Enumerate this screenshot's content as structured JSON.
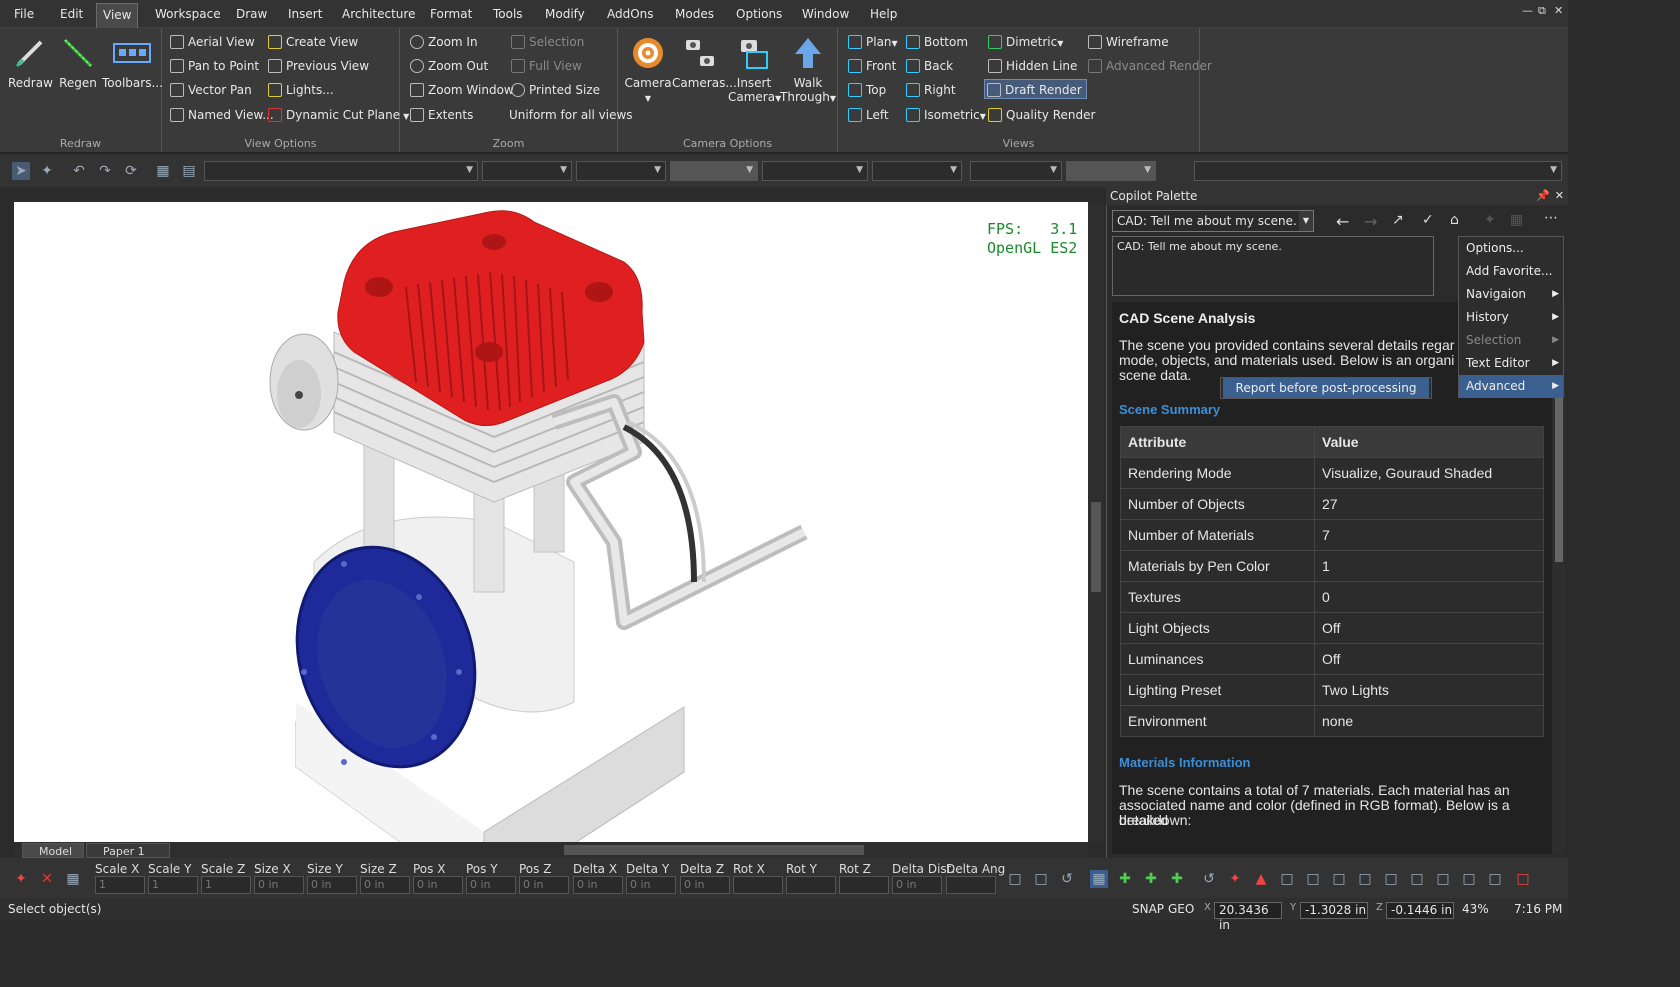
{
  "menu": [
    "File",
    "Edit",
    "View",
    "Workspace",
    "Draw",
    "Insert",
    "Architecture",
    "Format",
    "Tools",
    "Modify",
    "AddOns",
    "Modes",
    "Options",
    "Window",
    "Help"
  ],
  "ribbon": {
    "redraw_group": {
      "label": "Redraw",
      "buttons": [
        "Redraw",
        "Regen",
        "Toolbars..."
      ]
    },
    "view_options": {
      "label": "View Options",
      "buttons": [
        "Aerial View",
        "Pan to Point",
        "Vector Pan",
        "Named View...",
        "Create View",
        "Previous View",
        "Lights...",
        "Dynamic Cut Plane"
      ]
    },
    "zoom": {
      "label": "Zoom",
      "buttons": [
        "Zoom In",
        "Zoom Out",
        "Zoom Window",
        "Extents",
        "Selection",
        "Full View",
        "Printed Size",
        "Uniform for all views"
      ]
    },
    "camera_options": {
      "label": "Camera Options",
      "camera": "Camera",
      "cameras": "Cameras...",
      "insert_camera": "Insert Camera",
      "walk_through": "Walk Through"
    },
    "views": {
      "label": "Views",
      "buttons": [
        "Plan",
        "Front",
        "Top",
        "Left",
        "Bottom",
        "Back",
        "Right",
        "Isometric",
        "Dimetric",
        "Hidden Line",
        "Draft Render",
        "Quality Render",
        "Wireframe",
        "Advanced Render"
      ]
    }
  },
  "viewport": {
    "fps_label": "FPS:",
    "fps_value": "3.1",
    "renderer": "OpenGL ES2"
  },
  "tabs": [
    "Model",
    "Paper 1"
  ],
  "copilot": {
    "title": "Copilot Palette",
    "prompt_select": "CAD: Tell me about my scene.",
    "prompt_text": "CAD: Tell me about my scene.",
    "report_title": "CAD Scene Analysis",
    "intro": [
      "The scene you provided contains several details regar",
      "mode, objects, and materials used. Below is an organi",
      "scene data."
    ],
    "scene_summary": "Scene Summary",
    "table_headers": [
      "Attribute",
      "Value"
    ],
    "rows": [
      [
        "Rendering Mode",
        "Visualize, Gouraud Shaded"
      ],
      [
        "Number of Objects",
        "27"
      ],
      [
        "Number of Materials",
        "7"
      ],
      [
        "Materials by Pen Color",
        "1"
      ],
      [
        "Textures",
        "0"
      ],
      [
        "Light Objects",
        "Off"
      ],
      [
        "Luminances",
        "Off"
      ],
      [
        "Lighting Preset",
        "Two Lights"
      ],
      [
        "Environment",
        "none"
      ]
    ],
    "materials_info": "Materials Information",
    "materials_text": [
      "The scene contains a total of 7 materials. Each material has an",
      "associated name and color (defined in RGB format). Below is a detailed",
      "breakdown:"
    ],
    "menu": [
      {
        "label": "Options...",
        "sub": false,
        "disabled": false
      },
      {
        "label": "Add Favorite...",
        "sub": false,
        "disabled": false
      },
      {
        "label": "Navigaion",
        "sub": true,
        "disabled": false
      },
      {
        "label": "History",
        "sub": true,
        "disabled": false
      },
      {
        "label": "Selection",
        "sub": true,
        "disabled": true
      },
      {
        "label": "Text Editor",
        "sub": true,
        "disabled": false
      },
      {
        "label": "Advanced",
        "sub": true,
        "disabled": false,
        "highlight": true
      }
    ],
    "submenu_item": "Report before post-processing"
  },
  "bottom_fields": [
    "Scale X",
    "Scale Y",
    "Scale Z",
    "Size X",
    "Size Y",
    "Size Z",
    "Pos X",
    "Pos Y",
    "Pos Z",
    "Delta X",
    "Delta Y",
    "Delta Z",
    "Rot X",
    "Rot Y",
    "Rot Z",
    "Delta Dist.",
    "Delta Ang"
  ],
  "field_placeholder": "0 in",
  "field_placeholder_num": "1",
  "status": {
    "message": "Select object(s)",
    "snap": "SNAP",
    "geo": "GEO",
    "x": "20.3436 in",
    "y": "-1.3028 in",
    "z": "-0.1446 in",
    "zoom": "43%",
    "time": "7:16 PM"
  },
  "colors": {
    "accent": "#3b5f8f",
    "cylinder_head": "#e02020",
    "cover": "#1e2a9a",
    "fps_text": "#1a8a2a",
    "link": "#3b8fd8"
  }
}
